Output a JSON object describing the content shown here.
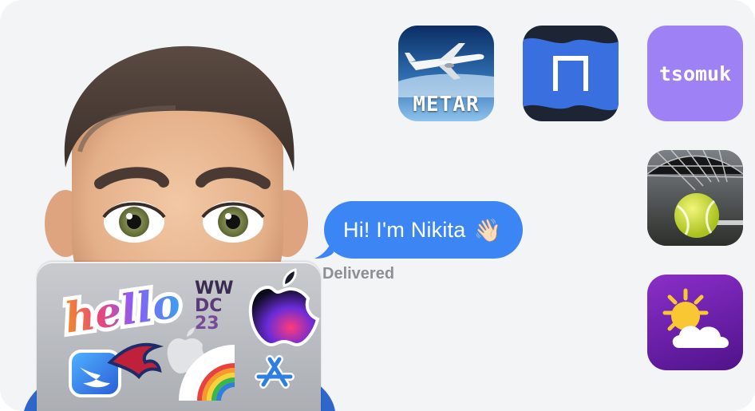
{
  "message": {
    "text": "Hi! I'm Nikita",
    "emoji": "👋🏻",
    "status": "Delivered",
    "bubble_color": "#3b86f4"
  },
  "laptop": {
    "stickers": [
      "hello",
      "WWDC23",
      "apple-rainbow-logo",
      "swift",
      "apple-logo",
      "rainbow",
      "app-store"
    ],
    "sticker_hello_text": "hello",
    "sticker_wwdc_text": "WWDC23"
  },
  "apps": [
    {
      "name": "METAR",
      "label": "METAR",
      "icon": "airplane-icon"
    },
    {
      "name": "Gate",
      "icon": "gate-icon"
    },
    {
      "name": "tsomuk",
      "label": "tsomuk",
      "icon": "text-logo"
    },
    {
      "name": "Tennis",
      "icon": "tennis-ball-icon"
    },
    {
      "name": "Weather",
      "icon": "sun-cloud-icon"
    }
  ],
  "colors": {
    "background": "#f3f4f6",
    "tsomuk_purple": "#9d81f5",
    "weather_purple": "#6a1fa8",
    "gate_blue": "#3a6fe0"
  }
}
